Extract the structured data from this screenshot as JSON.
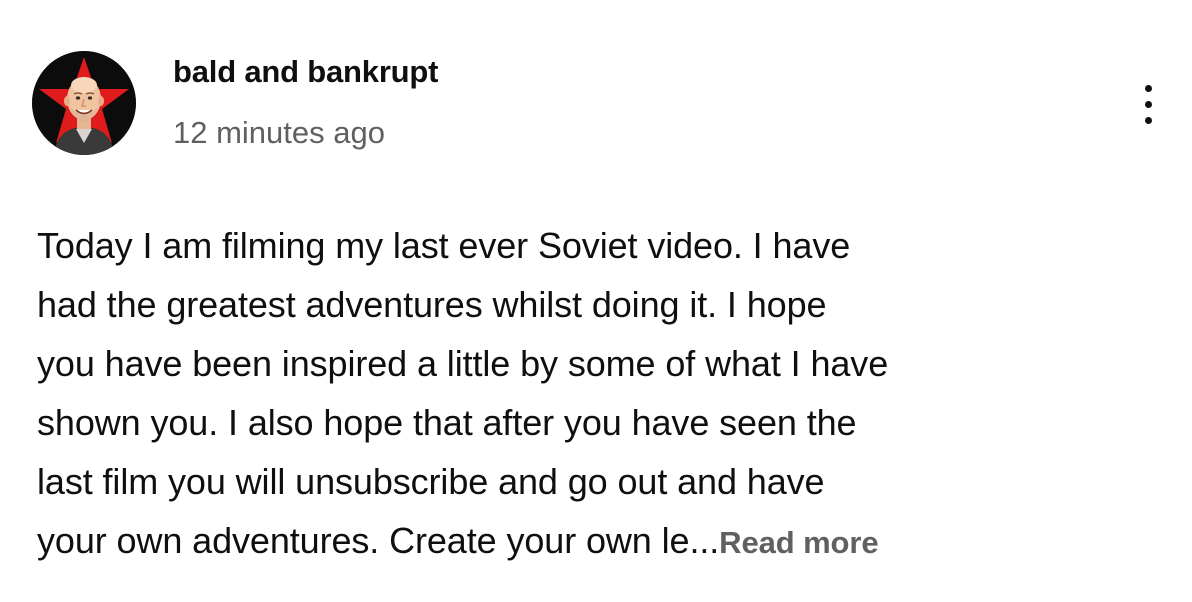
{
  "post": {
    "author": "bald and bankrupt",
    "timestamp": "12 minutes ago",
    "menu_icon": "more-vert-icon",
    "body_lines": [
      "Today I am filming my last ever Soviet video. I have",
      "had the greatest adventures whilst doing it. I hope",
      "you have been inspired a little by some of what I have",
      "shown you. I also hope that after you have seen the",
      "last film you will unsubscribe and go out and have",
      "your own adventures. Create your own le"
    ],
    "ellipsis": "...",
    "read_more": "Read more"
  },
  "colors": {
    "text_primary": "#0f0f0f",
    "text_secondary": "#606060",
    "avatar_star": "#e01b1b",
    "background": "#ffffff"
  }
}
